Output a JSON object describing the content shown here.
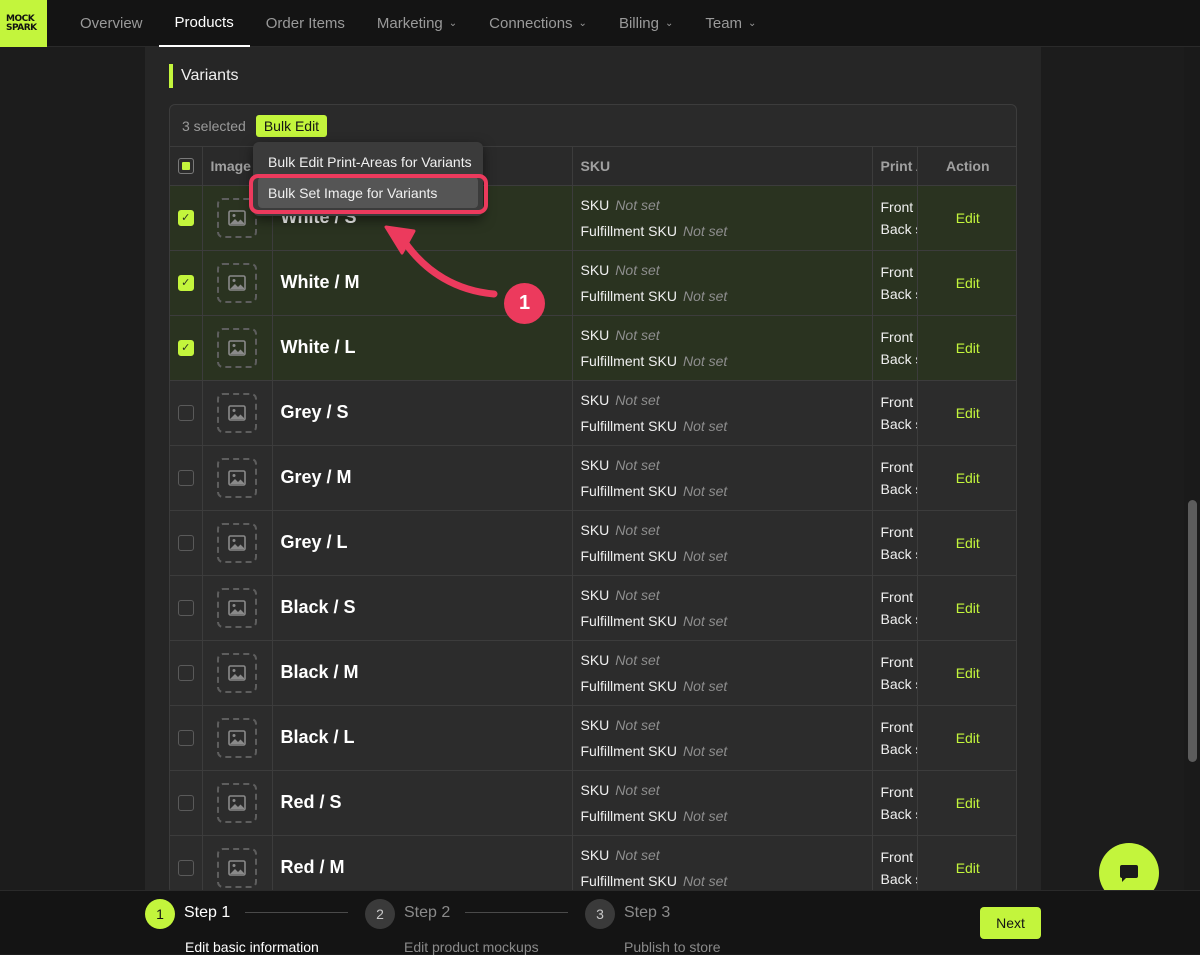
{
  "nav": {
    "logo_line1": "MOCK",
    "logo_line2": "SPARK",
    "items": [
      {
        "label": "Overview"
      },
      {
        "label": "Products"
      },
      {
        "label": "Order Items"
      },
      {
        "label": "Marketing"
      },
      {
        "label": "Connections"
      },
      {
        "label": "Billing"
      },
      {
        "label": "Team"
      }
    ]
  },
  "section": {
    "title": "Variants"
  },
  "bulk": {
    "selected_text": "3 selected",
    "button_label": "Bulk Edit"
  },
  "dropdown": {
    "items": [
      {
        "label": "Bulk Edit Print-Areas for Variants"
      },
      {
        "label": "Bulk Set Image for Variants"
      }
    ]
  },
  "table": {
    "headers": {
      "image": "Image",
      "sku": "SKU",
      "print": "Print Areas",
      "action": "Action"
    },
    "sku_label": "SKU",
    "fulfillment_label": "Fulfillment SKU",
    "not_set": "Not set",
    "print_front": "Front",
    "print_back": "Back side",
    "edit_label": "Edit",
    "rows": [
      {
        "name": "White / S",
        "selected": true
      },
      {
        "name": "White / M",
        "selected": true
      },
      {
        "name": "White / L",
        "selected": true
      },
      {
        "name": "Grey / S",
        "selected": false
      },
      {
        "name": "Grey / M",
        "selected": false
      },
      {
        "name": "Grey / L",
        "selected": false
      },
      {
        "name": "Black / S",
        "selected": false
      },
      {
        "name": "Black / M",
        "selected": false
      },
      {
        "name": "Black / L",
        "selected": false
      },
      {
        "name": "Red / S",
        "selected": false
      },
      {
        "name": "Red / M",
        "selected": false
      }
    ]
  },
  "annotation": {
    "number": "1"
  },
  "steps": [
    {
      "num": "1",
      "title": "Step 1",
      "desc": "Edit basic information"
    },
    {
      "num": "2",
      "title": "Step 2",
      "desc": "Edit product mockups"
    },
    {
      "num": "3",
      "title": "Step 3",
      "desc": "Publish to store"
    }
  ],
  "next_label": "Next",
  "colors": {
    "accent": "#c3f53c",
    "annotation": "#ec3a5d"
  }
}
